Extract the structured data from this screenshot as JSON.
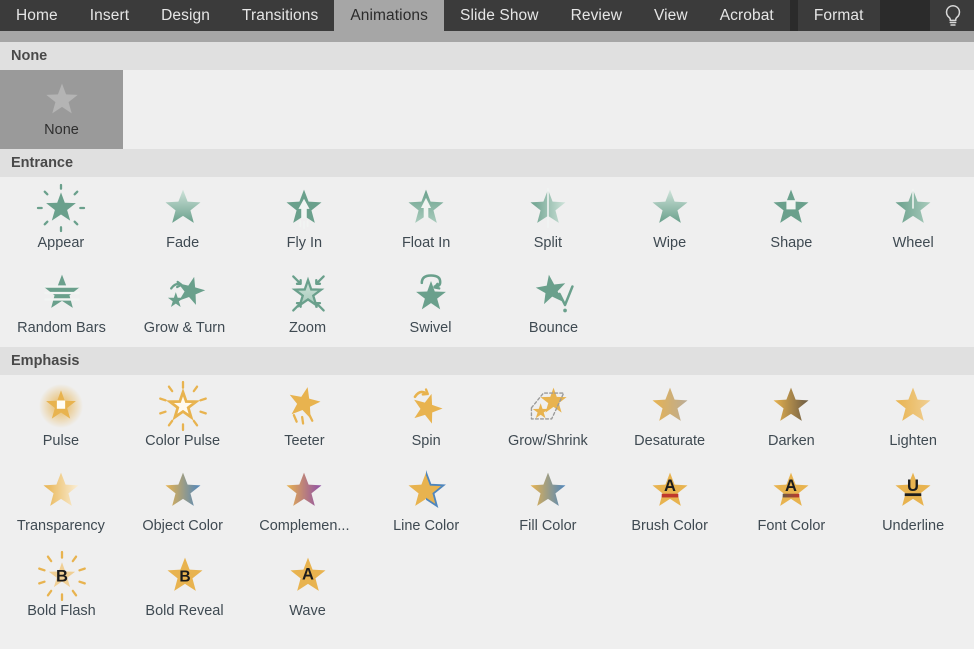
{
  "app": {
    "ribbon": {
      "tabs": [
        {
          "label": "Home",
          "active": false
        },
        {
          "label": "Insert",
          "active": false
        },
        {
          "label": "Design",
          "active": false
        },
        {
          "label": "Transitions",
          "active": false
        },
        {
          "label": "Animations",
          "active": true
        },
        {
          "label": "Slide Show",
          "active": false
        },
        {
          "label": "Review",
          "active": false
        },
        {
          "label": "View",
          "active": false
        },
        {
          "label": "Acrobat",
          "active": false
        },
        {
          "label": "Format",
          "active": false
        }
      ],
      "tell_me_icon": "lightbulb-icon"
    }
  },
  "colors": {
    "tab_bar_bg": "#2b2b2b",
    "tab_bg": "#3b3b3b",
    "tab_active_bg": "#a6a6a6",
    "ribbon_underline": "#a6a6a6",
    "gallery_bg": "#efefef",
    "section_header_bg": "#e0e0e0",
    "section_header_text": "#494949",
    "tile_label_text": "#3f4a52",
    "selected_tile_bg": "#9a9a9a",
    "entrance_green": "#6aa08c",
    "entrance_green_light": "#a8cbbc",
    "entrance_green_pale": "#cfe3da",
    "emphasis_gold": "#e8b34f",
    "emphasis_gold_light": "#f0cf94",
    "emphasis_gold_pale": "#faeed6",
    "emphasis_gray": "#b9ab97",
    "emphasis_dark": "#6b5b45",
    "emphasis_blue": "#4f86bd",
    "emphasis_purple": "#8e4fa8",
    "glow_white": "#ffffff",
    "letter_dark": "#1c1c1c",
    "underline_red": "#c0392b",
    "outline_gray": "#9a9a9a"
  },
  "gallery": {
    "sections": [
      {
        "id": "none",
        "header": "None",
        "rows": [
          [
            {
              "label": "None",
              "icon": "none-star-icon",
              "selected": true
            }
          ]
        ]
      },
      {
        "id": "entrance",
        "header": "Entrance",
        "rows": [
          [
            {
              "label": "Appear",
              "icon": "appear-star-icon"
            },
            {
              "label": "Fade",
              "icon": "fade-star-icon"
            },
            {
              "label": "Fly In",
              "icon": "fly-in-star-icon"
            },
            {
              "label": "Float In",
              "icon": "float-in-star-icon"
            },
            {
              "label": "Split",
              "icon": "split-star-icon"
            },
            {
              "label": "Wipe",
              "icon": "wipe-star-icon"
            },
            {
              "label": "Shape",
              "icon": "shape-star-icon"
            },
            {
              "label": "Wheel",
              "icon": "wheel-star-icon"
            }
          ],
          [
            {
              "label": "Random Bars",
              "icon": "random-bars-star-icon"
            },
            {
              "label": "Grow & Turn",
              "icon": "grow-and-turn-star-icon"
            },
            {
              "label": "Zoom",
              "icon": "zoom-star-icon"
            },
            {
              "label": "Swivel",
              "icon": "swivel-star-icon"
            },
            {
              "label": "Bounce",
              "icon": "bounce-star-icon"
            }
          ]
        ]
      },
      {
        "id": "emphasis",
        "header": "Emphasis",
        "rows": [
          [
            {
              "label": "Pulse",
              "icon": "pulse-star-icon"
            },
            {
              "label": "Color Pulse",
              "icon": "color-pulse-star-icon"
            },
            {
              "label": "Teeter",
              "icon": "teeter-star-icon"
            },
            {
              "label": "Spin",
              "icon": "spin-star-icon"
            },
            {
              "label": "Grow/Shrink",
              "icon": "grow-shrink-star-icon"
            },
            {
              "label": "Desaturate",
              "icon": "desaturate-star-icon"
            },
            {
              "label": "Darken",
              "icon": "darken-star-icon"
            },
            {
              "label": "Lighten",
              "icon": "lighten-star-icon"
            }
          ],
          [
            {
              "label": "Transparency",
              "icon": "transparency-star-icon"
            },
            {
              "label": "Object Color",
              "icon": "object-color-star-icon"
            },
            {
              "label": "Complemen...",
              "icon": "complementary-color-star-icon"
            },
            {
              "label": "Line Color",
              "icon": "line-color-star-icon"
            },
            {
              "label": "Fill Color",
              "icon": "fill-color-star-icon"
            },
            {
              "label": "Brush Color",
              "icon": "brush-color-star-icon"
            },
            {
              "label": "Font Color",
              "icon": "font-color-star-icon"
            },
            {
              "label": "Underline",
              "icon": "underline-star-icon"
            }
          ],
          [
            {
              "label": "Bold Flash",
              "icon": "bold-flash-star-icon"
            },
            {
              "label": "Bold Reveal",
              "icon": "bold-reveal-star-icon"
            },
            {
              "label": "Wave",
              "icon": "wave-star-icon"
            }
          ]
        ]
      }
    ]
  }
}
